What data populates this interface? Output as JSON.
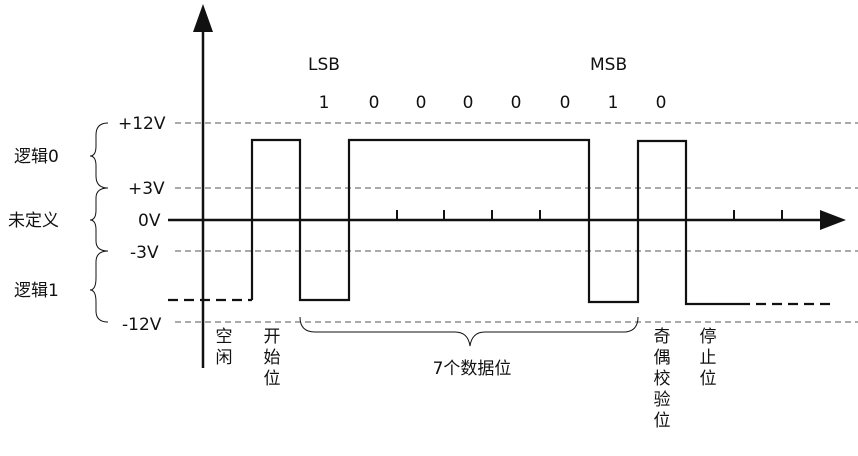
{
  "diagram": {
    "level_labels": {
      "p12": "+12V",
      "p3": "+3V",
      "zero": "0V",
      "m3": "-3V",
      "m12": "-12V"
    },
    "region_labels": {
      "logic0": "逻辑0",
      "undefined": "未定义",
      "logic1": "逻辑1"
    },
    "bit_order": {
      "lsb": "LSB",
      "msb": "MSB"
    },
    "data_bits": [
      "1",
      "0",
      "0",
      "0",
      "0",
      "0",
      "1",
      "0"
    ],
    "phase_labels": {
      "idle": "空闲",
      "start": "开始位",
      "data": "7个数据位",
      "parity": "奇偶校验位",
      "stop": "停止位"
    },
    "colors": {
      "line": "#111111",
      "dashed": "#444444"
    }
  }
}
